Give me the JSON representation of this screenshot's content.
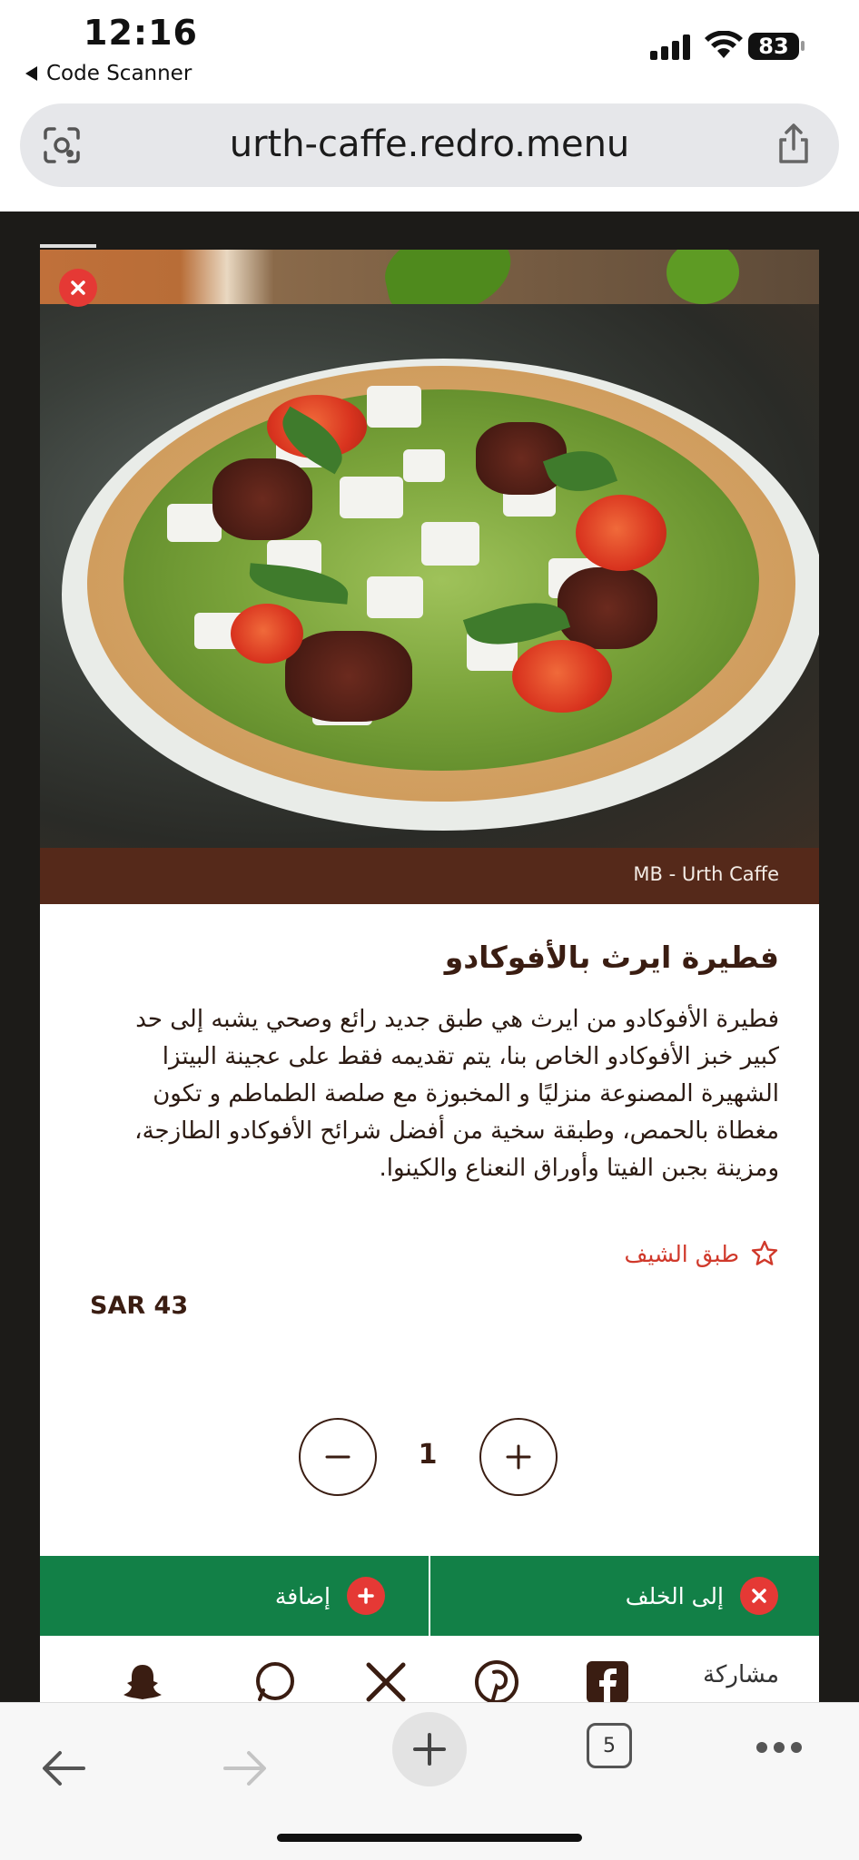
{
  "status_bar": {
    "time": "12:16",
    "back_app": "Code Scanner",
    "battery": "83"
  },
  "browser": {
    "url": "urth-caffe.redro.menu",
    "tab_count": "5"
  },
  "dish": {
    "photo_credit": "MB  -  Urth Caffe",
    "title": "فطيرة ايرث بالأفوكادو",
    "description": "فطيرة الأفوكادو من ايرث هي طبق جديد رائع وصحي يشبه إلى حد كبير خبز الأفوكادو الخاص بنا، يتم تقديمه فقط على عجينة البيتزا الشهيرة المصنوعة منزليًا و المخبوزة مع صلصة الطماطم و تكون مغطاة بالحمص، وطبقة سخية من أفضل شرائح الأفوكادو الطازجة، ومزينة بجبن الفيتا وأوراق النعناع والكينوا.",
    "chef_badge": "طبق الشيف",
    "price": "SAR 43",
    "quantity": "1"
  },
  "actions": {
    "add_label": "إضافة",
    "back_label": "إلى الخلف"
  },
  "share": {
    "label": "مشاركة",
    "icons": [
      "facebook-icon",
      "pinterest-icon",
      "x-icon",
      "whatsapp-icon",
      "snapchat-icon"
    ]
  },
  "colors": {
    "brand_brown": "#55291a",
    "action_green": "#128047",
    "close_red": "#e53935",
    "chef_red": "#d0392b"
  }
}
